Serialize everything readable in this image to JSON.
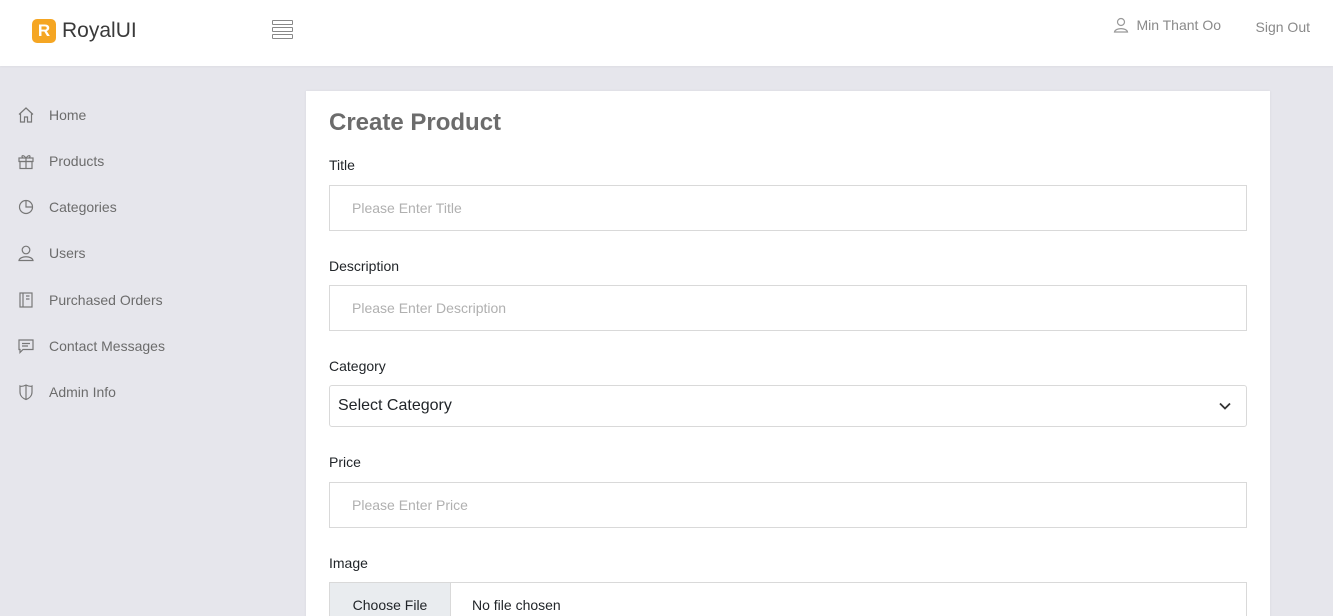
{
  "brand": {
    "logo_letter": "R",
    "name": "RoyalUI",
    "logo_color": "#f5a623"
  },
  "header": {
    "user_name": "Min Thant Oo",
    "signout_label": "Sign Out"
  },
  "sidebar": {
    "items": [
      {
        "label": "Home",
        "icon": "home-icon"
      },
      {
        "label": "Products",
        "icon": "gift-icon"
      },
      {
        "label": "Categories",
        "icon": "pie-chart-icon"
      },
      {
        "label": "Users",
        "icon": "user-icon"
      },
      {
        "label": "Purchased Orders",
        "icon": "book-icon"
      },
      {
        "label": "Contact Messages",
        "icon": "message-icon"
      },
      {
        "label": "Admin Info",
        "icon": "shield-icon"
      }
    ]
  },
  "form": {
    "title": "Create Product",
    "title_field": {
      "label": "Title",
      "placeholder": "Please Enter Title"
    },
    "description_field": {
      "label": "Description",
      "placeholder": "Please Enter Description"
    },
    "category_field": {
      "label": "Category",
      "selected": "Select Category"
    },
    "price_field": {
      "label": "Price",
      "placeholder": "Please Enter Price"
    },
    "image_field": {
      "label": "Image",
      "button_label": "Choose File",
      "file_status": "No file chosen"
    }
  }
}
